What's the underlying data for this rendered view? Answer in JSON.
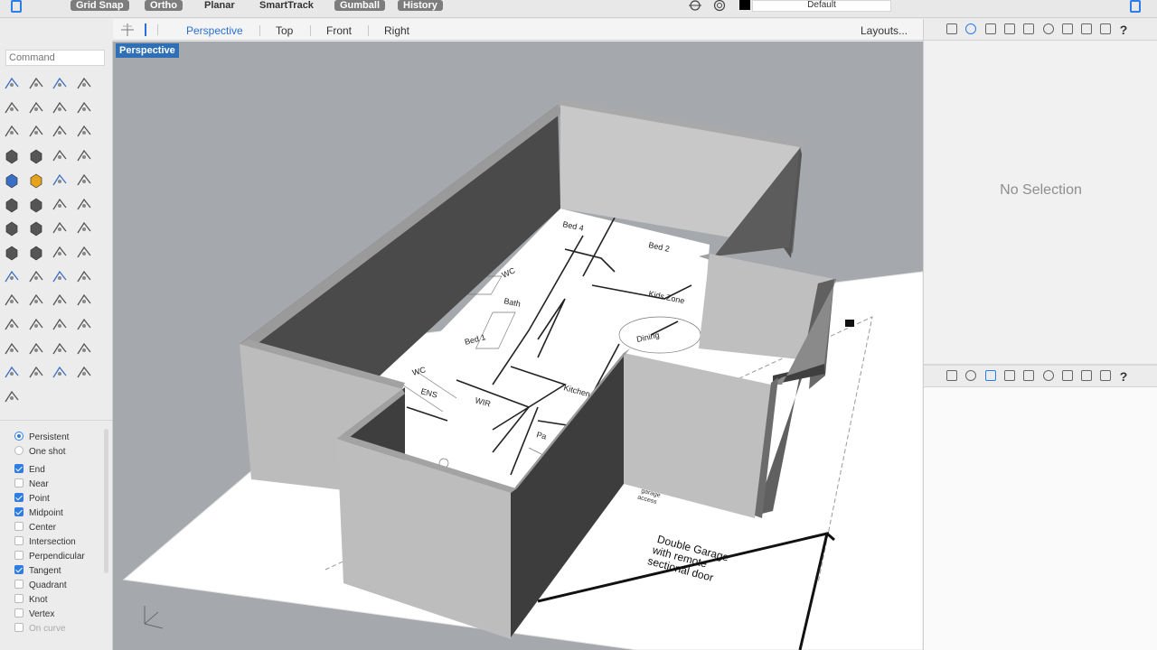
{
  "topbar": {
    "buttons": [
      {
        "label": "Grid Snap",
        "on": true
      },
      {
        "label": "Ortho",
        "on": true
      },
      {
        "label": "Planar",
        "on": false
      },
      {
        "label": "SmartTrack",
        "on": false
      },
      {
        "label": "Gumball",
        "on": true
      },
      {
        "label": "History",
        "on": true
      }
    ],
    "layer_label": "Default"
  },
  "viewtabs": {
    "tabs": [
      "Perspective",
      "Top",
      "Front",
      "Right"
    ],
    "active": "Perspective",
    "layouts": "Layouts..."
  },
  "command": {
    "placeholder": "Command"
  },
  "viewport": {
    "label": "Perspective"
  },
  "floorplan": {
    "rooms": [
      "Bed 4",
      "Bed 2",
      "WC",
      "Bath",
      "Bed 1",
      "Kids Zone",
      "Dining",
      "WC",
      "ENS",
      "WIR",
      "Kitchen",
      "Pa"
    ],
    "garage": "Double Garage\nwith remote\nsectional door",
    "garage_access": "Handy\ngarage\naccess"
  },
  "osnap": {
    "mode": [
      {
        "label": "Persistent",
        "selected": true
      },
      {
        "label": "One shot",
        "selected": false
      }
    ],
    "items": [
      {
        "label": "End",
        "checked": true
      },
      {
        "label": "Near",
        "checked": false
      },
      {
        "label": "Point",
        "checked": true
      },
      {
        "label": "Midpoint",
        "checked": true
      },
      {
        "label": "Center",
        "checked": false
      },
      {
        "label": "Intersection",
        "checked": false
      },
      {
        "label": "Perpendicular",
        "checked": false
      },
      {
        "label": "Tangent",
        "checked": true
      },
      {
        "label": "Quadrant",
        "checked": false
      },
      {
        "label": "Knot",
        "checked": false
      },
      {
        "label": "Vertex",
        "checked": false
      },
      {
        "label": "On curve",
        "checked": false
      }
    ]
  },
  "properties": {
    "empty_text": "No Selection"
  },
  "colors": {
    "accent": "#2b6fd6",
    "viewport_bg": "#a5a8ad",
    "label_bg": "#2f6fb6"
  }
}
